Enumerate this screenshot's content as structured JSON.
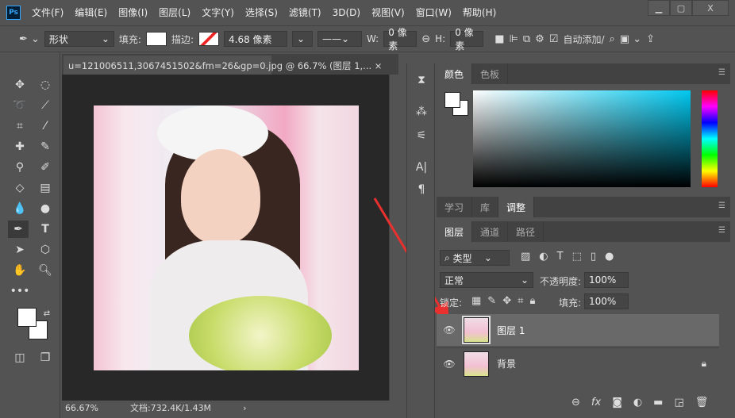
{
  "app": {
    "logo": "Ps"
  },
  "menu": [
    "文件(F)",
    "编辑(E)",
    "图像(I)",
    "图层(L)",
    "文字(Y)",
    "选择(S)",
    "滤镜(T)",
    "3D(D)",
    "视图(V)",
    "窗口(W)",
    "帮助(H)"
  ],
  "window_controls": {
    "minimize": "▁",
    "maximize": "▢",
    "close": "X"
  },
  "options": {
    "mode": "形状",
    "fill_label": "填充:",
    "stroke_label": "描边:",
    "stroke_width": "4.68 像素",
    "w_label": "W:",
    "w_value": "0 像素",
    "h_label": "H:",
    "h_value": "0 像素",
    "auto_add": "自动添加/"
  },
  "document": {
    "tab_title": "u=121006511,3067451502&fm=26&gp=0.jpg @ 66.7% (图层 1,...",
    "close": "×"
  },
  "status": {
    "zoom": "66.67%",
    "doc_size": "文档:732.4K/1.43M",
    "arrow": "›"
  },
  "color_panel": {
    "tabs": [
      "颜色",
      "色板"
    ]
  },
  "adjust_panel": {
    "tabs": [
      "学习",
      "库",
      "调整"
    ]
  },
  "layers_panel": {
    "tabs": [
      "图层",
      "通道",
      "路径"
    ],
    "filter": "类型",
    "blend_mode": "正常",
    "opacity_label": "不透明度:",
    "opacity": "100%",
    "lock_label": "锁定:",
    "fill_label": "填充:",
    "fill": "100%",
    "layers": [
      {
        "name": "图层 1",
        "selected": true,
        "locked": false
      },
      {
        "name": "背景",
        "selected": false,
        "locked": true
      }
    ]
  },
  "annotation": {
    "arrow_color": "#e8312f"
  }
}
